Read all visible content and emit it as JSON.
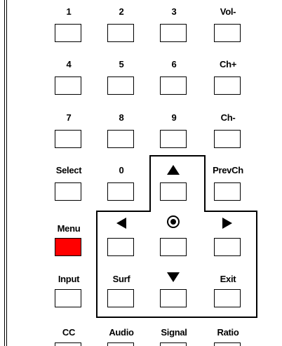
{
  "rows": [
    {
      "keys": [
        {
          "id": "1",
          "label": "1"
        },
        {
          "id": "2",
          "label": "2"
        },
        {
          "id": "3",
          "label": "3"
        },
        {
          "id": "vol-minus",
          "label": "Vol-"
        }
      ]
    },
    {
      "keys": [
        {
          "id": "4",
          "label": "4"
        },
        {
          "id": "5",
          "label": "5"
        },
        {
          "id": "6",
          "label": "6"
        },
        {
          "id": "ch-plus",
          "label": "Ch+"
        }
      ]
    },
    {
      "keys": [
        {
          "id": "7",
          "label": "7"
        },
        {
          "id": "8",
          "label": "8"
        },
        {
          "id": "9",
          "label": "9"
        },
        {
          "id": "ch-minus",
          "label": "Ch-"
        }
      ]
    },
    {
      "keys": [
        {
          "id": "select",
          "label": "Select"
        },
        {
          "id": "0",
          "label": "0"
        },
        {
          "id": "up",
          "label": "",
          "icon": "up-arrow-icon"
        },
        {
          "id": "prevch",
          "label": "PrevCh"
        }
      ]
    },
    {
      "keys": [
        {
          "id": "menu",
          "label": "Menu"
        },
        {
          "id": "left",
          "label": "",
          "icon": "left-arrow-icon"
        },
        {
          "id": "ok",
          "label": "",
          "icon": "ok-circle-icon"
        },
        {
          "id": "right",
          "label": "",
          "icon": "right-arrow-icon"
        }
      ]
    },
    {
      "keys": [
        {
          "id": "input",
          "label": "Input"
        },
        {
          "id": "surf",
          "label": "Surf"
        },
        {
          "id": "down",
          "label": "",
          "icon": "down-arrow-icon"
        },
        {
          "id": "exit",
          "label": "Exit"
        }
      ]
    },
    {
      "keys": [
        {
          "id": "cc",
          "label": "CC"
        },
        {
          "id": "audio",
          "label": "Audio"
        },
        {
          "id": "signal",
          "label": "Signal"
        },
        {
          "id": "ratio",
          "label": "Ratio"
        }
      ]
    }
  ],
  "colors": {
    "menu_button": "#ff0000",
    "button_face": "#ffffff",
    "outline": "#000000"
  }
}
